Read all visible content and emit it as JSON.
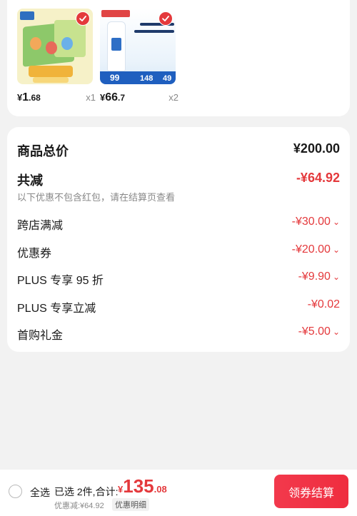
{
  "products": [
    {
      "price_currency": "¥",
      "price_int": "1",
      "price_dec": ".68",
      "qty": "x1",
      "icon": "snack-box-product-image"
    },
    {
      "price_currency": "¥",
      "price_int": "66",
      "price_dec": ".7",
      "qty": "x2",
      "icon": "skincare-product-image"
    }
  ],
  "thumb2_prices": {
    "a": "99",
    "b": "148",
    "c": "49"
  },
  "summary": {
    "total_label": "商品总价",
    "total_value": "¥200.00",
    "reduce_label": "共减",
    "reduce_value": "-¥64.92",
    "note": "以下优惠不包含红包，请在结算页查看",
    "items": [
      {
        "label": "跨店满减",
        "value": "-¥30.00",
        "chevron": true
      },
      {
        "label": "优惠券",
        "value": "-¥20.00",
        "chevron": true
      },
      {
        "label": "PLUS 专享 95 折",
        "value": "-¥9.90",
        "chevron": true
      },
      {
        "label": "PLUS 专享立减",
        "value": "-¥0.02",
        "chevron": false
      },
      {
        "label": "首购礼金",
        "value": "-¥5.00",
        "chevron": true
      }
    ]
  },
  "bottom": {
    "select_all": "全选",
    "selected_info": "已选 2件,合计:",
    "total_cur": "¥",
    "total_int": "135",
    "total_dec": ".08",
    "discount_line": "优惠减:¥64.92",
    "detail_link": "优惠明细",
    "checkout": "领券结算"
  },
  "colors": {
    "accent": "#e4393c",
    "card": "#ffffff",
    "bg": "#f2f2f2"
  }
}
